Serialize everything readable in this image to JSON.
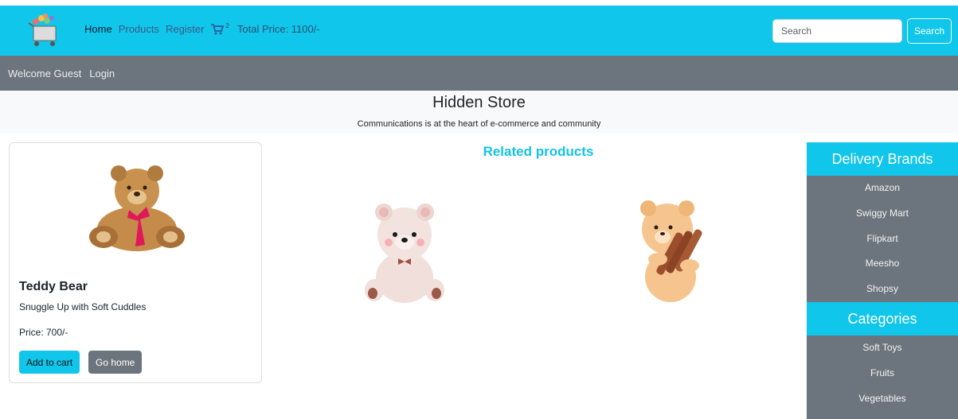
{
  "navbar": {
    "links": [
      "Home",
      "Products",
      "Register"
    ],
    "cart_count": "2",
    "total_price": "Total Price: 1100/-",
    "search_placeholder": "Search",
    "search_button": "Search"
  },
  "userbar": {
    "welcome": "Welcome Guest",
    "login": "Login"
  },
  "hero": {
    "title": "Hidden Store",
    "subtitle": "Communications is at the heart of e-commerce and community"
  },
  "product": {
    "title": "Teddy Bear",
    "description": "Snuggle Up with Soft Cuddles",
    "price": "Price: 700/-",
    "add_to_cart": "Add to cart",
    "go_home": "Go home"
  },
  "related": {
    "title": "Related products"
  },
  "sidebar": {
    "brands_title": "Delivery Brands",
    "brands": [
      "Amazon",
      "Swiggy Mart",
      "Flipkart",
      "Meesho",
      "Shopsy"
    ],
    "categories_title": "Categories",
    "categories": [
      "Soft Toys",
      "Fruits",
      "Vegetables"
    ]
  },
  "colors": {
    "primary": "#10c6ea",
    "secondary": "#6c757d",
    "light": "#f8f9fa"
  }
}
